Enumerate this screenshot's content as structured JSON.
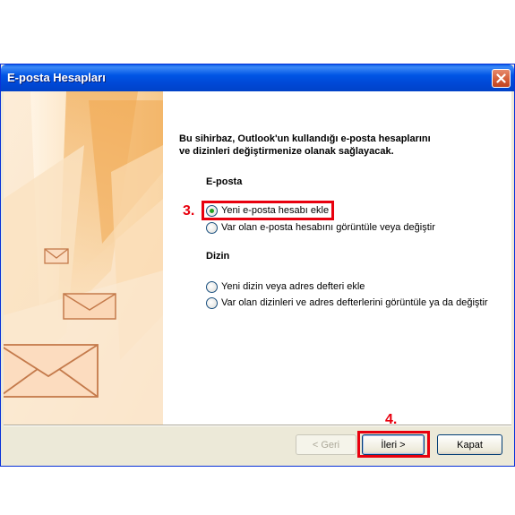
{
  "window": {
    "title": "E-posta Hesapları"
  },
  "intro": {
    "line1": "Bu sihirbaz, Outlook'un kullandığı e-posta hesaplarını",
    "line2": "ve dizinleri değiştirmenize olanak sağlayacak."
  },
  "email_section": {
    "heading": "E-posta",
    "options": [
      {
        "label": "Yeni e-posta hesabı ekle",
        "checked": true
      },
      {
        "label": "Var olan e-posta hesabını görüntüle veya değiştir",
        "checked": false
      }
    ]
  },
  "directory_section": {
    "heading": "Dizin",
    "options": [
      {
        "label": "Yeni dizin veya adres defteri ekle",
        "checked": false
      },
      {
        "label": "Var olan dizinleri ve adres defterlerini görüntüle ya da değiştir",
        "checked": false
      }
    ]
  },
  "annotations": {
    "step3": "3.",
    "step4": "4."
  },
  "buttons": {
    "back": "< Geri",
    "next": "İleri >",
    "close": "Kapat"
  },
  "colors": {
    "titlebar": "#0055e5",
    "highlight": "#e8000e",
    "dialog_bg": "#ece9d8"
  },
  "icons": {
    "close": "close-icon",
    "envelope": "envelope-icon"
  }
}
